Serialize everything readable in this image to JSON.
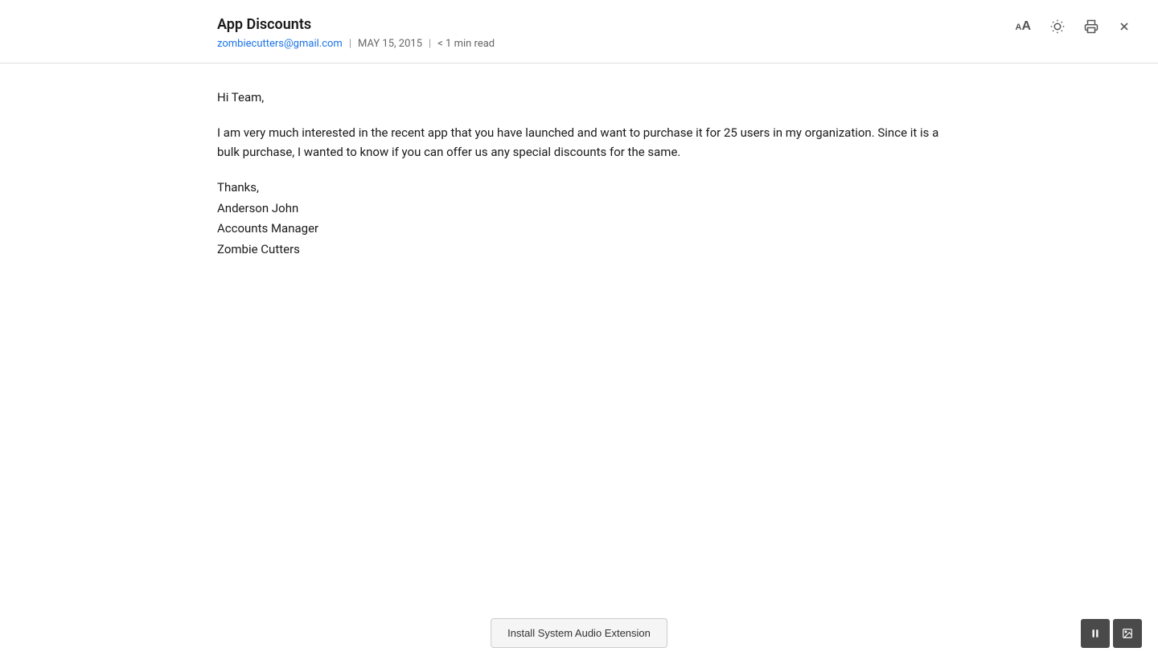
{
  "header": {
    "title": "App Discounts",
    "sender_email": "zombiecutters@gmail.com",
    "date": "MAY 15, 2015",
    "read_time": "< 1 min read",
    "separator": "|"
  },
  "body": {
    "greeting": "Hi Team,",
    "paragraph": "I am very much interested in the recent app that you have launched and want to purchase it for 25 users in my organization. Since it is a bulk purchase, I wanted to know if you can offer us any special discounts for the same.",
    "closing": "Thanks,",
    "name": "Anderson John",
    "title": "Accounts Manager",
    "company": "Zombie Cutters"
  },
  "toolbar": {
    "font_size_icon": "Aa",
    "brightness_icon": "☀",
    "print_icon": "🖨",
    "close_icon": "✕"
  },
  "bottom": {
    "install_label": "Install System Audio Extension",
    "pause_icon": "⏸",
    "image_icon": "⊞"
  }
}
